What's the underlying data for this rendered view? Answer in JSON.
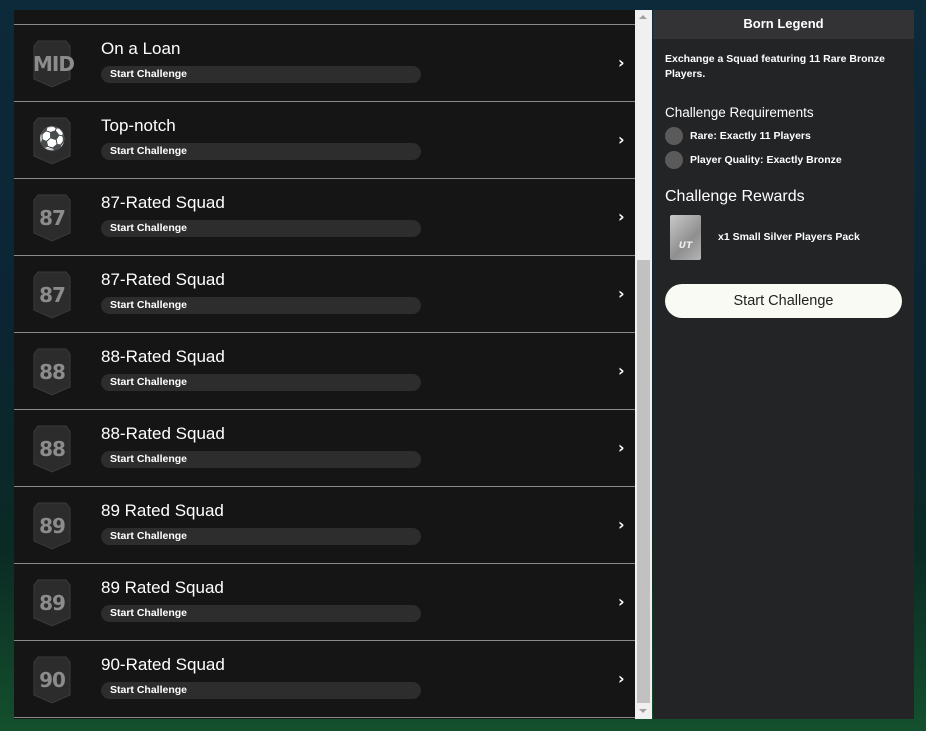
{
  "challenges": [
    {
      "title": "On a Loan",
      "badge": "MID",
      "icon": "player-mid-icon",
      "button": "Start Challenge"
    },
    {
      "title": "Top-notch",
      "badge": "",
      "icon": "player-kick-icon",
      "button": "Start Challenge"
    },
    {
      "title": "87-Rated Squad",
      "badge": "87",
      "icon": "rating-badge-icon",
      "button": "Start Challenge"
    },
    {
      "title": "87-Rated Squad",
      "badge": "87",
      "icon": "rating-badge-icon",
      "button": "Start Challenge"
    },
    {
      "title": "88-Rated Squad",
      "badge": "88",
      "icon": "rating-badge-icon",
      "button": "Start Challenge"
    },
    {
      "title": "88-Rated Squad",
      "badge": "88",
      "icon": "rating-badge-icon",
      "button": "Start Challenge"
    },
    {
      "title": "89 Rated Squad",
      "badge": "89",
      "icon": "rating-badge-icon",
      "button": "Start Challenge"
    },
    {
      "title": "89 Rated Squad",
      "badge": "89",
      "icon": "rating-badge-icon",
      "button": "Start Challenge"
    },
    {
      "title": "90-Rated Squad",
      "badge": "90",
      "icon": "rating-badge-icon",
      "button": "Start Challenge"
    }
  ],
  "panel": {
    "title": "Born Legend",
    "description": "Exchange a Squad featuring 11 Rare Bronze Players.",
    "requirements_heading": "Challenge Requirements",
    "requirements": [
      "Rare: Exactly 11 Players",
      "Player Quality: Exactly Bronze"
    ],
    "rewards_heading": "Challenge Rewards",
    "reward": "x1 Small Silver Players Pack",
    "pack_label": "UT",
    "start_button": "Start Challenge"
  }
}
